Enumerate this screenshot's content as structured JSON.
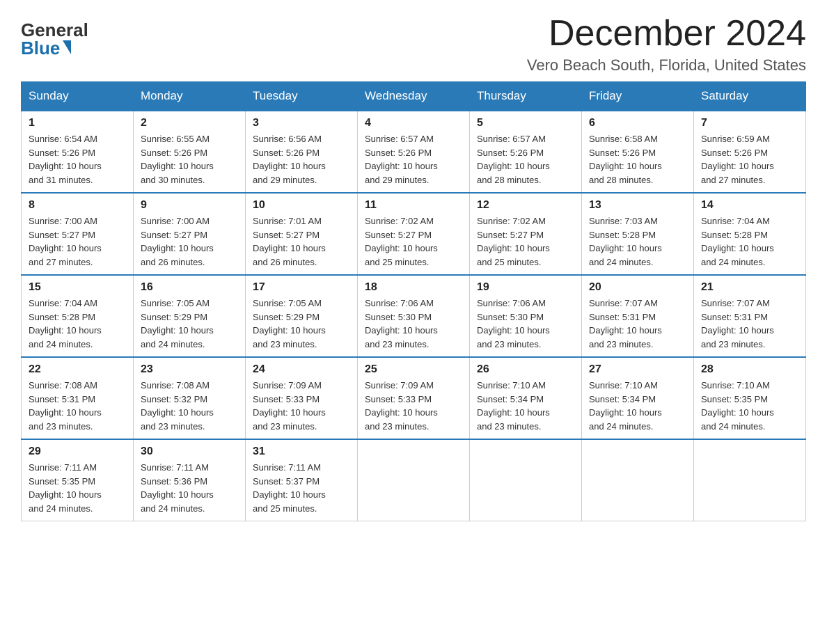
{
  "logo": {
    "general": "General",
    "blue": "Blue"
  },
  "title": "December 2024",
  "location": "Vero Beach South, Florida, United States",
  "weekdays": [
    "Sunday",
    "Monday",
    "Tuesday",
    "Wednesday",
    "Thursday",
    "Friday",
    "Saturday"
  ],
  "weeks": [
    [
      {
        "day": "1",
        "sunrise": "6:54 AM",
        "sunset": "5:26 PM",
        "daylight": "10 hours and 31 minutes."
      },
      {
        "day": "2",
        "sunrise": "6:55 AM",
        "sunset": "5:26 PM",
        "daylight": "10 hours and 30 minutes."
      },
      {
        "day": "3",
        "sunrise": "6:56 AM",
        "sunset": "5:26 PM",
        "daylight": "10 hours and 29 minutes."
      },
      {
        "day": "4",
        "sunrise": "6:57 AM",
        "sunset": "5:26 PM",
        "daylight": "10 hours and 29 minutes."
      },
      {
        "day": "5",
        "sunrise": "6:57 AM",
        "sunset": "5:26 PM",
        "daylight": "10 hours and 28 minutes."
      },
      {
        "day": "6",
        "sunrise": "6:58 AM",
        "sunset": "5:26 PM",
        "daylight": "10 hours and 28 minutes."
      },
      {
        "day": "7",
        "sunrise": "6:59 AM",
        "sunset": "5:26 PM",
        "daylight": "10 hours and 27 minutes."
      }
    ],
    [
      {
        "day": "8",
        "sunrise": "7:00 AM",
        "sunset": "5:27 PM",
        "daylight": "10 hours and 27 minutes."
      },
      {
        "day": "9",
        "sunrise": "7:00 AM",
        "sunset": "5:27 PM",
        "daylight": "10 hours and 26 minutes."
      },
      {
        "day": "10",
        "sunrise": "7:01 AM",
        "sunset": "5:27 PM",
        "daylight": "10 hours and 26 minutes."
      },
      {
        "day": "11",
        "sunrise": "7:02 AM",
        "sunset": "5:27 PM",
        "daylight": "10 hours and 25 minutes."
      },
      {
        "day": "12",
        "sunrise": "7:02 AM",
        "sunset": "5:27 PM",
        "daylight": "10 hours and 25 minutes."
      },
      {
        "day": "13",
        "sunrise": "7:03 AM",
        "sunset": "5:28 PM",
        "daylight": "10 hours and 24 minutes."
      },
      {
        "day": "14",
        "sunrise": "7:04 AM",
        "sunset": "5:28 PM",
        "daylight": "10 hours and 24 minutes."
      }
    ],
    [
      {
        "day": "15",
        "sunrise": "7:04 AM",
        "sunset": "5:28 PM",
        "daylight": "10 hours and 24 minutes."
      },
      {
        "day": "16",
        "sunrise": "7:05 AM",
        "sunset": "5:29 PM",
        "daylight": "10 hours and 24 minutes."
      },
      {
        "day": "17",
        "sunrise": "7:05 AM",
        "sunset": "5:29 PM",
        "daylight": "10 hours and 23 minutes."
      },
      {
        "day": "18",
        "sunrise": "7:06 AM",
        "sunset": "5:30 PM",
        "daylight": "10 hours and 23 minutes."
      },
      {
        "day": "19",
        "sunrise": "7:06 AM",
        "sunset": "5:30 PM",
        "daylight": "10 hours and 23 minutes."
      },
      {
        "day": "20",
        "sunrise": "7:07 AM",
        "sunset": "5:31 PM",
        "daylight": "10 hours and 23 minutes."
      },
      {
        "day": "21",
        "sunrise": "7:07 AM",
        "sunset": "5:31 PM",
        "daylight": "10 hours and 23 minutes."
      }
    ],
    [
      {
        "day": "22",
        "sunrise": "7:08 AM",
        "sunset": "5:31 PM",
        "daylight": "10 hours and 23 minutes."
      },
      {
        "day": "23",
        "sunrise": "7:08 AM",
        "sunset": "5:32 PM",
        "daylight": "10 hours and 23 minutes."
      },
      {
        "day": "24",
        "sunrise": "7:09 AM",
        "sunset": "5:33 PM",
        "daylight": "10 hours and 23 minutes."
      },
      {
        "day": "25",
        "sunrise": "7:09 AM",
        "sunset": "5:33 PM",
        "daylight": "10 hours and 23 minutes."
      },
      {
        "day": "26",
        "sunrise": "7:10 AM",
        "sunset": "5:34 PM",
        "daylight": "10 hours and 23 minutes."
      },
      {
        "day": "27",
        "sunrise": "7:10 AM",
        "sunset": "5:34 PM",
        "daylight": "10 hours and 24 minutes."
      },
      {
        "day": "28",
        "sunrise": "7:10 AM",
        "sunset": "5:35 PM",
        "daylight": "10 hours and 24 minutes."
      }
    ],
    [
      {
        "day": "29",
        "sunrise": "7:11 AM",
        "sunset": "5:35 PM",
        "daylight": "10 hours and 24 minutes."
      },
      {
        "day": "30",
        "sunrise": "7:11 AM",
        "sunset": "5:36 PM",
        "daylight": "10 hours and 24 minutes."
      },
      {
        "day": "31",
        "sunrise": "7:11 AM",
        "sunset": "5:37 PM",
        "daylight": "10 hours and 25 minutes."
      },
      null,
      null,
      null,
      null
    ]
  ],
  "labels": {
    "sunrise": "Sunrise:",
    "sunset": "Sunset:",
    "daylight": "Daylight:"
  }
}
